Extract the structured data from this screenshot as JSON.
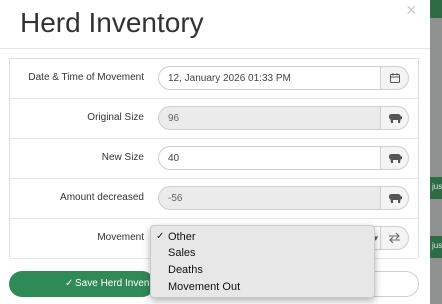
{
  "modal": {
    "title": "Herd Inventory",
    "close_glyph": "×"
  },
  "form": {
    "date_time": {
      "label": "Date & Time of Movement",
      "value": "12, January 2026 01:33 PM",
      "icon": "calendar-icon"
    },
    "original_size": {
      "label": "Original Size",
      "value": "96",
      "icon": "cow-icon"
    },
    "new_size": {
      "label": "New Size",
      "value": "40",
      "icon": "cow-icon"
    },
    "amount_decreased": {
      "label": "Amount decreased",
      "value": "-56",
      "icon": "cow-icon"
    },
    "movement": {
      "label": "Movement",
      "selected": "Other",
      "icon": "transfer-icon",
      "options": [
        "Other",
        "Sales",
        "Deaths",
        "Movement Out"
      ]
    }
  },
  "footer": {
    "save_label": "Save Herd Inventory",
    "save_icon": "✓"
  },
  "background": {
    "fragment_label": "jus"
  },
  "colors": {
    "primary_green": "#2f8a57",
    "backdrop_green": "#2f6b45"
  }
}
